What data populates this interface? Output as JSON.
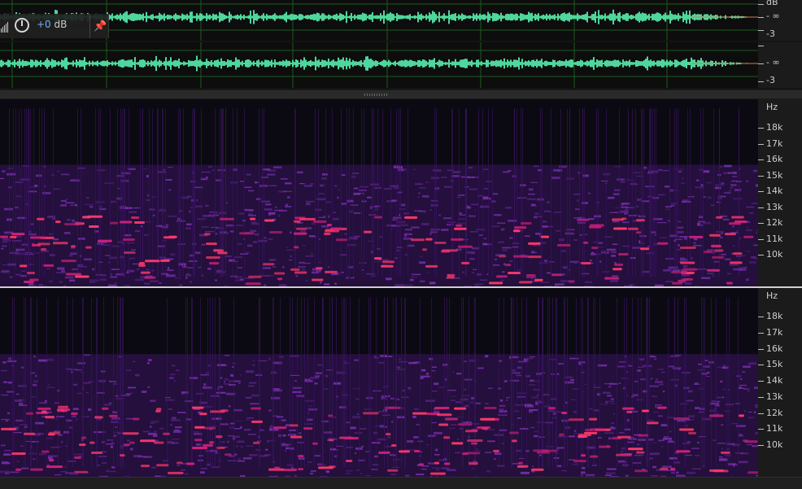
{
  "waveform": {
    "scale_unit": "dB",
    "scale_labels": [
      "- ∞",
      "-3"
    ],
    "channel_2_labels": [
      "- ∞",
      "-3"
    ],
    "wave_color": "#4fd69c",
    "grid_color": "#1f5c1f"
  },
  "hud": {
    "gain_value": "+0",
    "gain_unit": "dB",
    "icons": [
      "level-meter-icon",
      "power-knob-icon",
      "pin-icon"
    ]
  },
  "spectrogram": {
    "unit": "Hz",
    "freq_labels": [
      "18k",
      "17k",
      "16k",
      "15k",
      "14k",
      "13k",
      "12k",
      "11k",
      "10k"
    ],
    "palette": [
      "#0b0a12",
      "#3a1460",
      "#7a2fb0",
      "#d0207a",
      "#ff3a6a"
    ]
  }
}
